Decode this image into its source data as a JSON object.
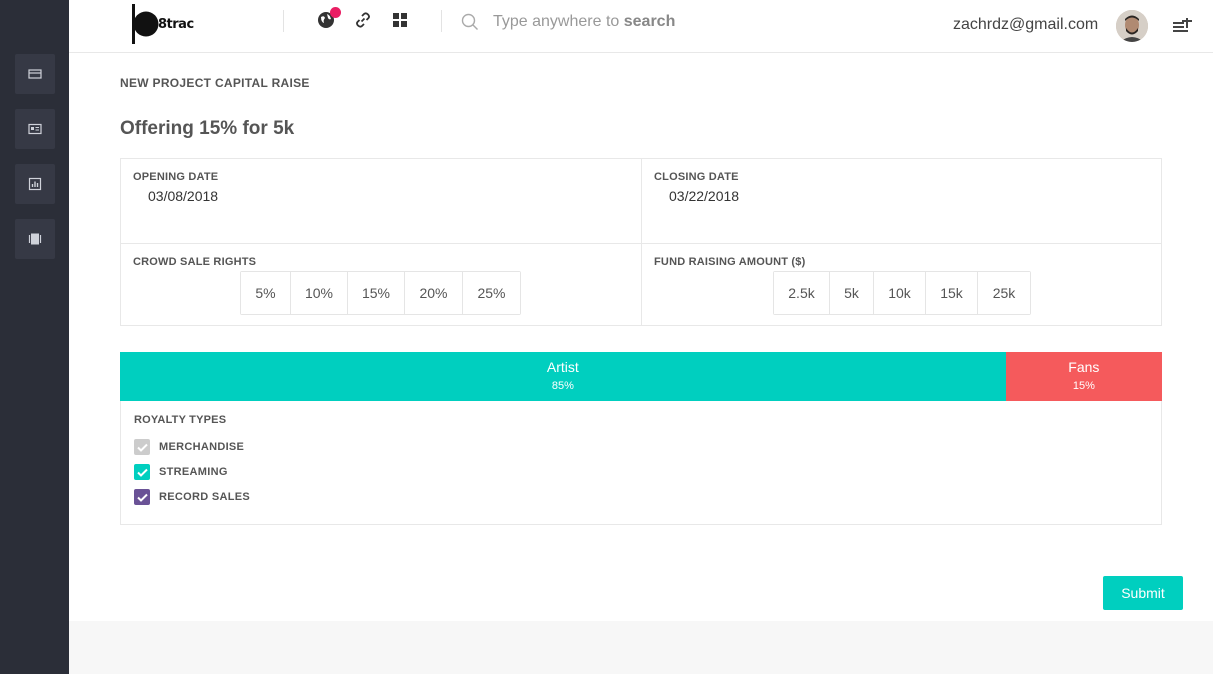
{
  "app": {
    "logo_text": "8trac"
  },
  "header": {
    "search_prefix": "Type anywhere to ",
    "search_bold": "search",
    "user_email": "zachrdz@gmail.com"
  },
  "page": {
    "label": "NEW PROJECT CAPITAL RAISE",
    "title": "Offering 15% for 5k"
  },
  "form": {
    "opening_date_label": "OPENING DATE",
    "opening_date_value": "03/08/2018",
    "closing_date_label": "CLOSING DATE",
    "closing_date_value": "03/22/2018",
    "crowd_sale_label": "CROWD SALE RIGHTS",
    "crowd_sale_options": [
      "5%",
      "10%",
      "15%",
      "20%",
      "25%"
    ],
    "fund_label": "FUND RAISING AMOUNT ($)",
    "fund_options": [
      "2.5k",
      "5k",
      "10k",
      "15k",
      "25k"
    ]
  },
  "split": {
    "artist_label": "Artist",
    "artist_pct": "85%",
    "artist_share": 85,
    "fans_label": "Fans",
    "fans_pct": "15%",
    "fans_share": 15,
    "artist_color": "#00cfbf",
    "fans_color": "#f55a5c"
  },
  "royalty": {
    "label": "ROYALTY TYPES",
    "items": [
      {
        "label": "MERCHANDISE",
        "checked": true,
        "color": "#cccccc"
      },
      {
        "label": "STREAMING",
        "checked": true,
        "color": "#00cfbf"
      },
      {
        "label": "RECORD SALES",
        "checked": true,
        "color": "#6a5296"
      }
    ]
  },
  "actions": {
    "submit_label": "Submit"
  },
  "colors": {
    "accent": "#00cfbf",
    "sidebar": "#2b2e38",
    "notification": "#e91e63"
  }
}
